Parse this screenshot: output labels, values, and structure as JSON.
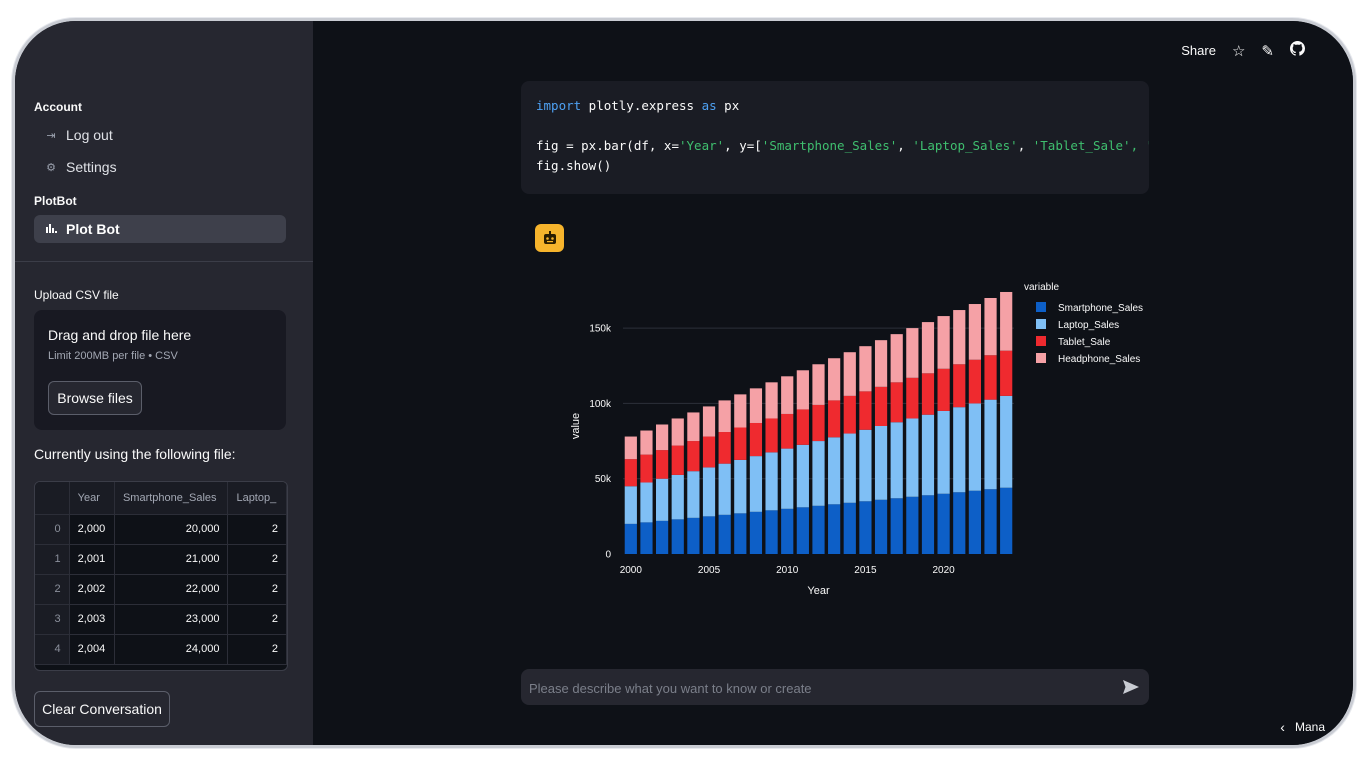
{
  "sidebar": {
    "account_heading": "Account",
    "logout_label": "Log out",
    "settings_label": "Settings",
    "plotbot_heading": "PlotBot",
    "plotbot_item_label": "Plot Bot",
    "upload_heading": "Upload CSV file",
    "upload_title": "Drag and drop file here",
    "upload_sub": "Limit 200MB per file • CSV",
    "browse_label": "Browse files",
    "using_label": "Currently using the following file:",
    "table": {
      "headers": [
        "",
        "Year",
        "Smartphone_Sales",
        "Laptop_"
      ],
      "rows": [
        {
          "idx": "0",
          "year": "2,000",
          "smart": "20,000",
          "laptop": "2"
        },
        {
          "idx": "1",
          "year": "2,001",
          "smart": "21,000",
          "laptop": "2"
        },
        {
          "idx": "2",
          "year": "2,002",
          "smart": "22,000",
          "laptop": "2"
        },
        {
          "idx": "3",
          "year": "2,003",
          "smart": "23,000",
          "laptop": "2"
        },
        {
          "idx": "4",
          "year": "2,004",
          "smart": "24,000",
          "laptop": "2"
        }
      ]
    },
    "clear_label": "Clear Conversation"
  },
  "topbar": {
    "share_label": "Share"
  },
  "code": {
    "line1_kw": "import",
    "line1_mid": " plotly.express ",
    "line1_kw2": "as",
    "line1_end": " px",
    "line2_a": "fig = px.bar(df, x=",
    "line2_s1": "'Year'",
    "line2_b": ", y=[",
    "line2_s2": "'Smartphone_Sales'",
    "line2_c": ", ",
    "line2_s3": "'Laptop_Sales'",
    "line2_d": ", ",
    "line2_s4": "'Tablet_Sale'",
    "line2_e": ", '",
    "line3": "fig.show()"
  },
  "chat": {
    "placeholder": "Please describe what you want to know or create"
  },
  "footer": {
    "manage_label": "Mana"
  },
  "colors": {
    "smartphone": "#0d5fc7",
    "laptop": "#7fbff5",
    "tablet": "#ef2a2f",
    "headphone": "#f5a1a6"
  },
  "chart_data": {
    "type": "bar",
    "stacked": true,
    "xlabel": "Year",
    "ylabel": "value",
    "legend_title": "variable",
    "legend_position": "top-right",
    "ylim": [
      0,
      170000
    ],
    "yticks": [
      0,
      50000,
      100000,
      150000
    ],
    "ytick_labels": [
      "0",
      "50k",
      "100k",
      "150k"
    ],
    "xticks": [
      2000,
      2005,
      2010,
      2015,
      2020
    ],
    "x": [
      2000,
      2001,
      2002,
      2003,
      2004,
      2005,
      2006,
      2007,
      2008,
      2009,
      2010,
      2011,
      2012,
      2013,
      2014,
      2015,
      2016,
      2017,
      2018,
      2019,
      2020,
      2021,
      2022,
      2023,
      2024
    ],
    "series": [
      {
        "name": "Smartphone_Sales",
        "values": [
          20000,
          21000,
          22000,
          23000,
          24000,
          25000,
          26000,
          27000,
          28000,
          29000,
          30000,
          31000,
          32000,
          33000,
          34000,
          35000,
          36000,
          37000,
          38000,
          39000,
          40000,
          41000,
          42000,
          43000,
          44000
        ]
      },
      {
        "name": "Laptop_Sales",
        "values": [
          25000,
          26500,
          28000,
          29500,
          31000,
          32500,
          34000,
          35500,
          37000,
          38500,
          40000,
          41500,
          43000,
          44500,
          46000,
          47500,
          49000,
          50500,
          52000,
          53500,
          55000,
          56500,
          58000,
          59500,
          61000
        ]
      },
      {
        "name": "Tablet_Sale",
        "values": [
          18000,
          18500,
          19000,
          19500,
          20000,
          20500,
          21000,
          21500,
          22000,
          22500,
          23000,
          23500,
          24000,
          24500,
          25000,
          25500,
          26000,
          26500,
          27000,
          27500,
          28000,
          28500,
          29000,
          29500,
          30000
        ]
      },
      {
        "name": "Headphone_Sales",
        "values": [
          15000,
          16000,
          17000,
          18000,
          19000,
          20000,
          21000,
          22000,
          23000,
          24000,
          25000,
          26000,
          27000,
          28000,
          29000,
          30000,
          31000,
          32000,
          33000,
          34000,
          35000,
          36000,
          37000,
          38000,
          39000
        ]
      }
    ]
  }
}
